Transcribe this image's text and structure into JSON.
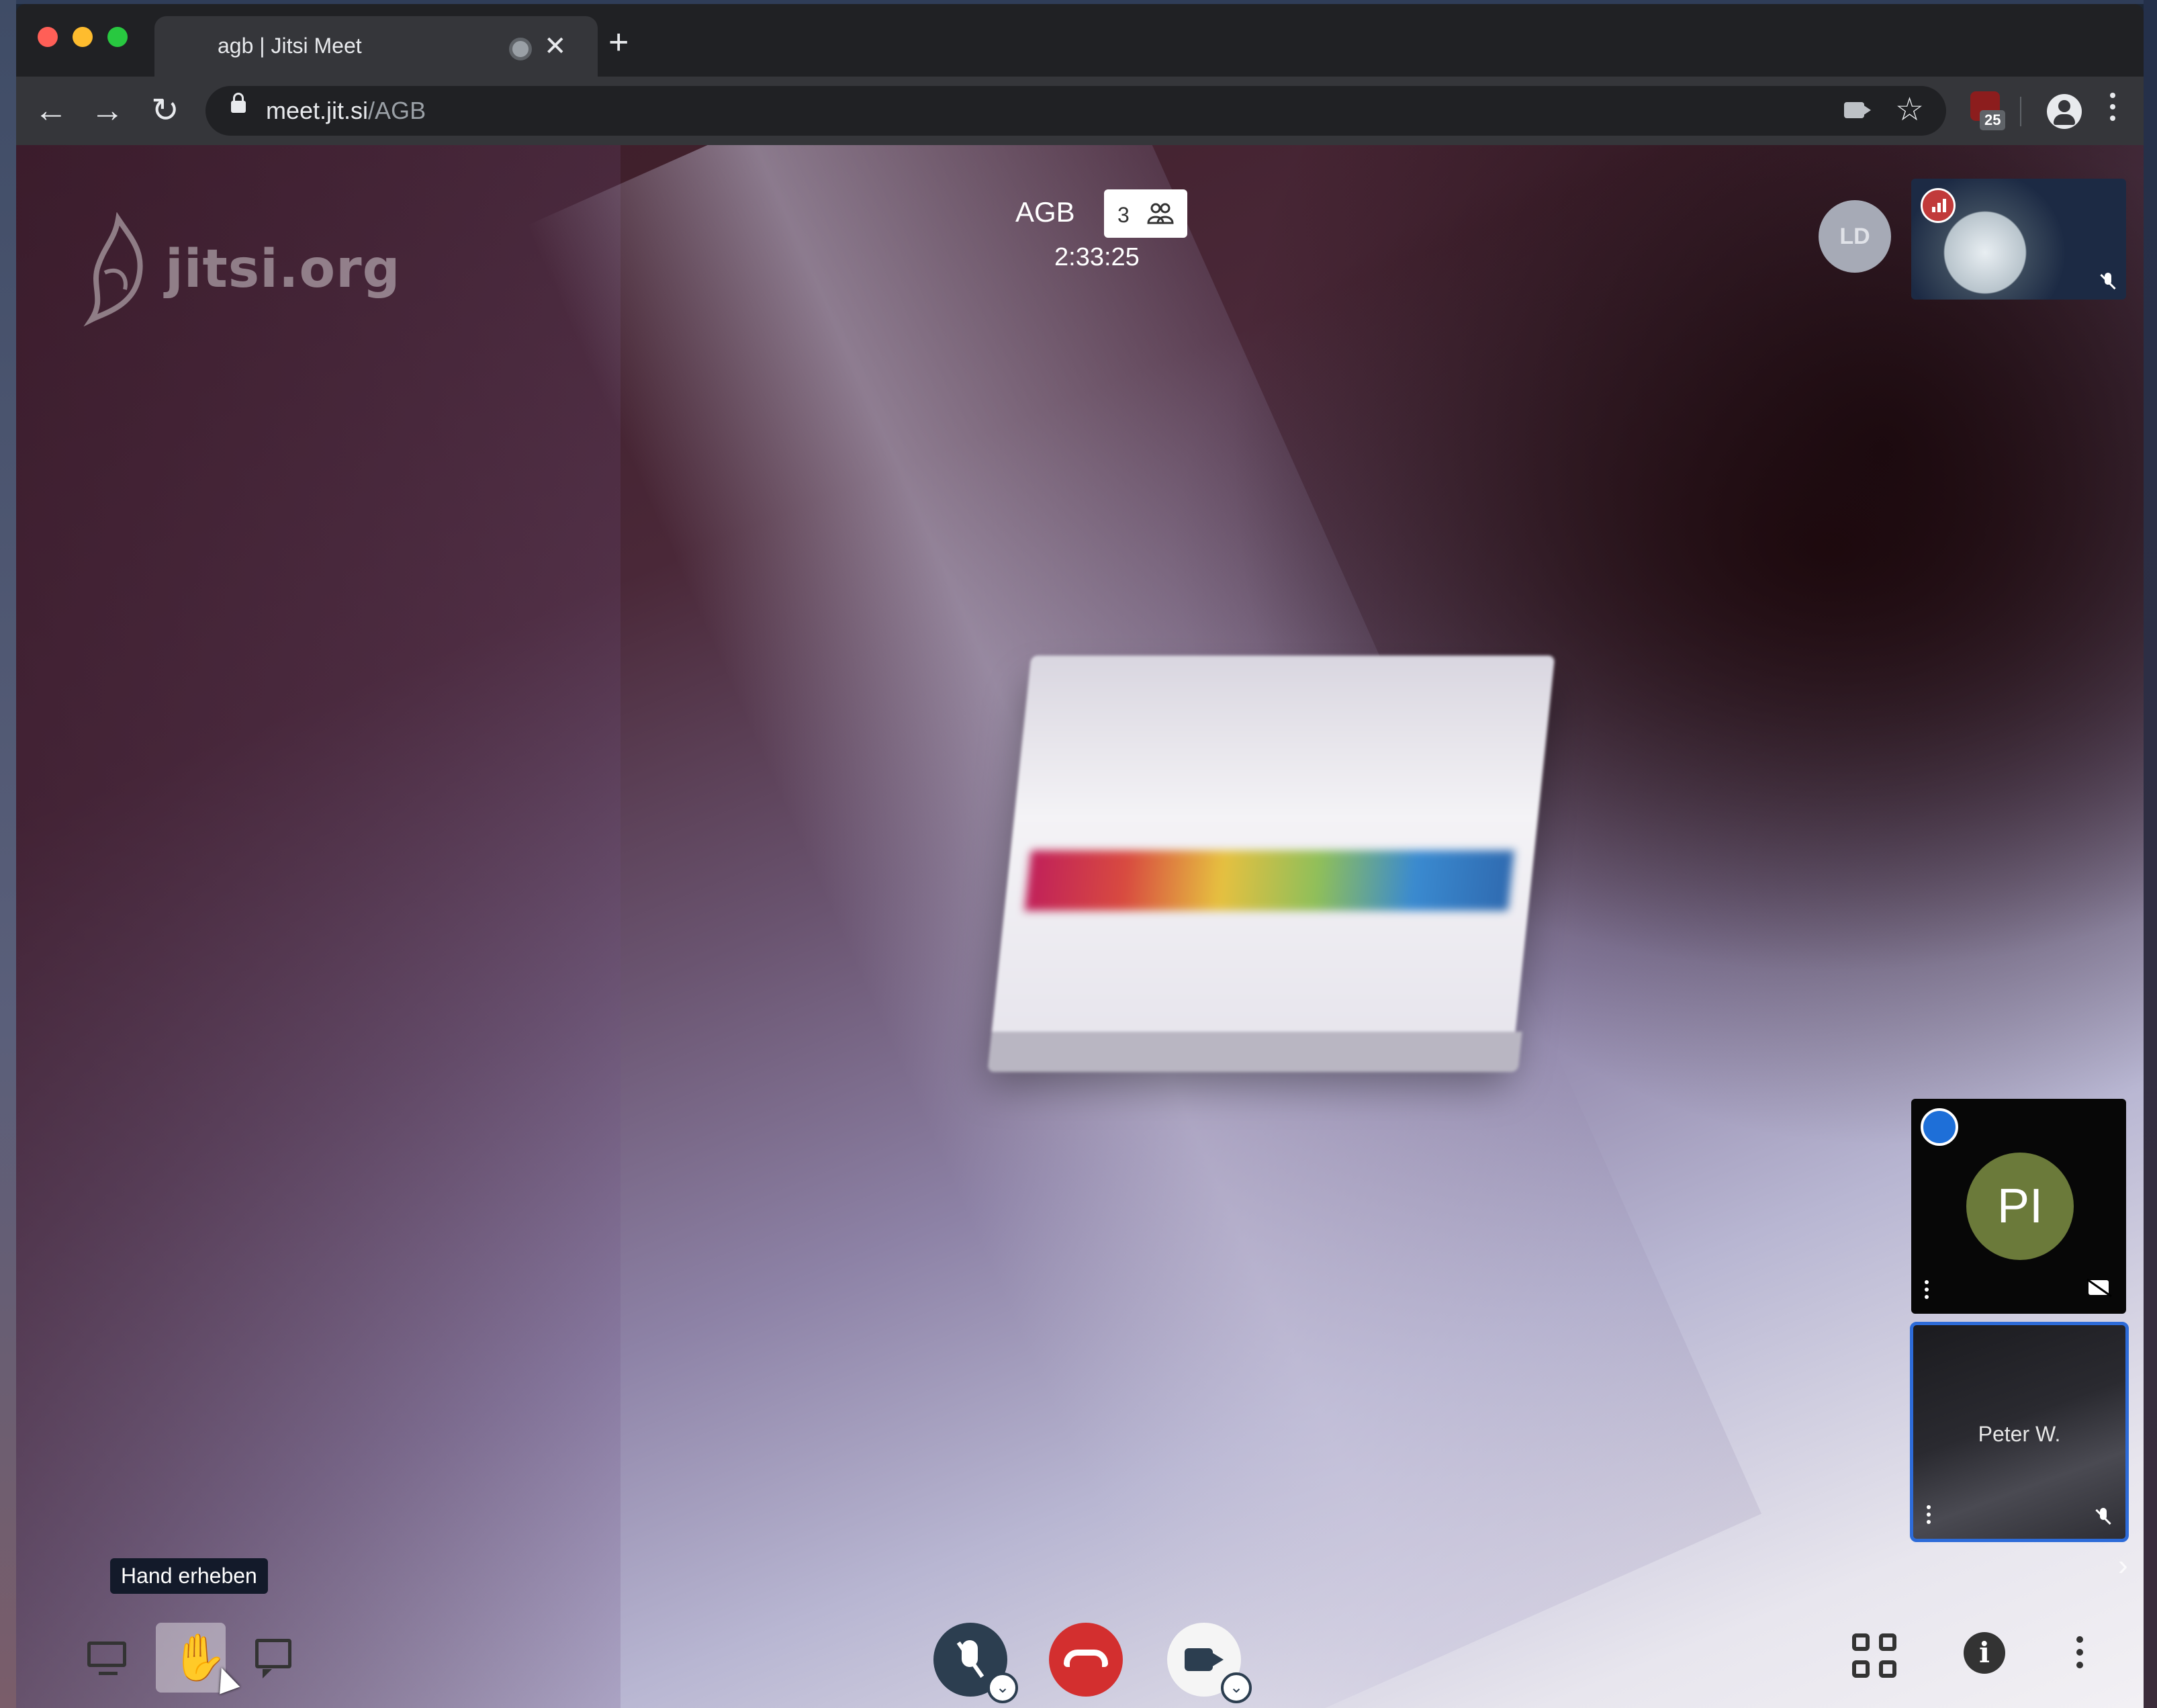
{
  "browser": {
    "tab_title": "agb | Jitsi Meet",
    "new_tab_label": "+",
    "close_tab_label": "✕",
    "url_host": "meet.jit.si",
    "url_path": "/AGB",
    "extension_badge": "25",
    "nav": {
      "back": "←",
      "forward": "→",
      "reload": "↻",
      "star": "☆"
    }
  },
  "meeting": {
    "watermark": "jitsi.org",
    "room_name": "AGB",
    "participant_count": "3",
    "timer": "2:33:25",
    "colors": {
      "hangup": "#d32f2f",
      "active_speaker_border": "#2d6bd8",
      "dominant_badge": "#1e6fd8"
    }
  },
  "participants": {
    "local_avatar_initials": "LD",
    "remote_avatar_initials": "PI",
    "pinned_name": "Peter W."
  },
  "toolbar": {
    "tooltip": "Hand erheben",
    "hand_icon": "✋",
    "info_label": "i",
    "device_arrow": "⌄",
    "filmstrip_toggle": "›",
    "icons": [
      "screen-share-icon",
      "raise-hand-icon",
      "chat-icon",
      "microphone-muted-icon",
      "hangup-icon",
      "camera-icon",
      "tile-view-icon",
      "info-icon",
      "more-icon"
    ]
  }
}
